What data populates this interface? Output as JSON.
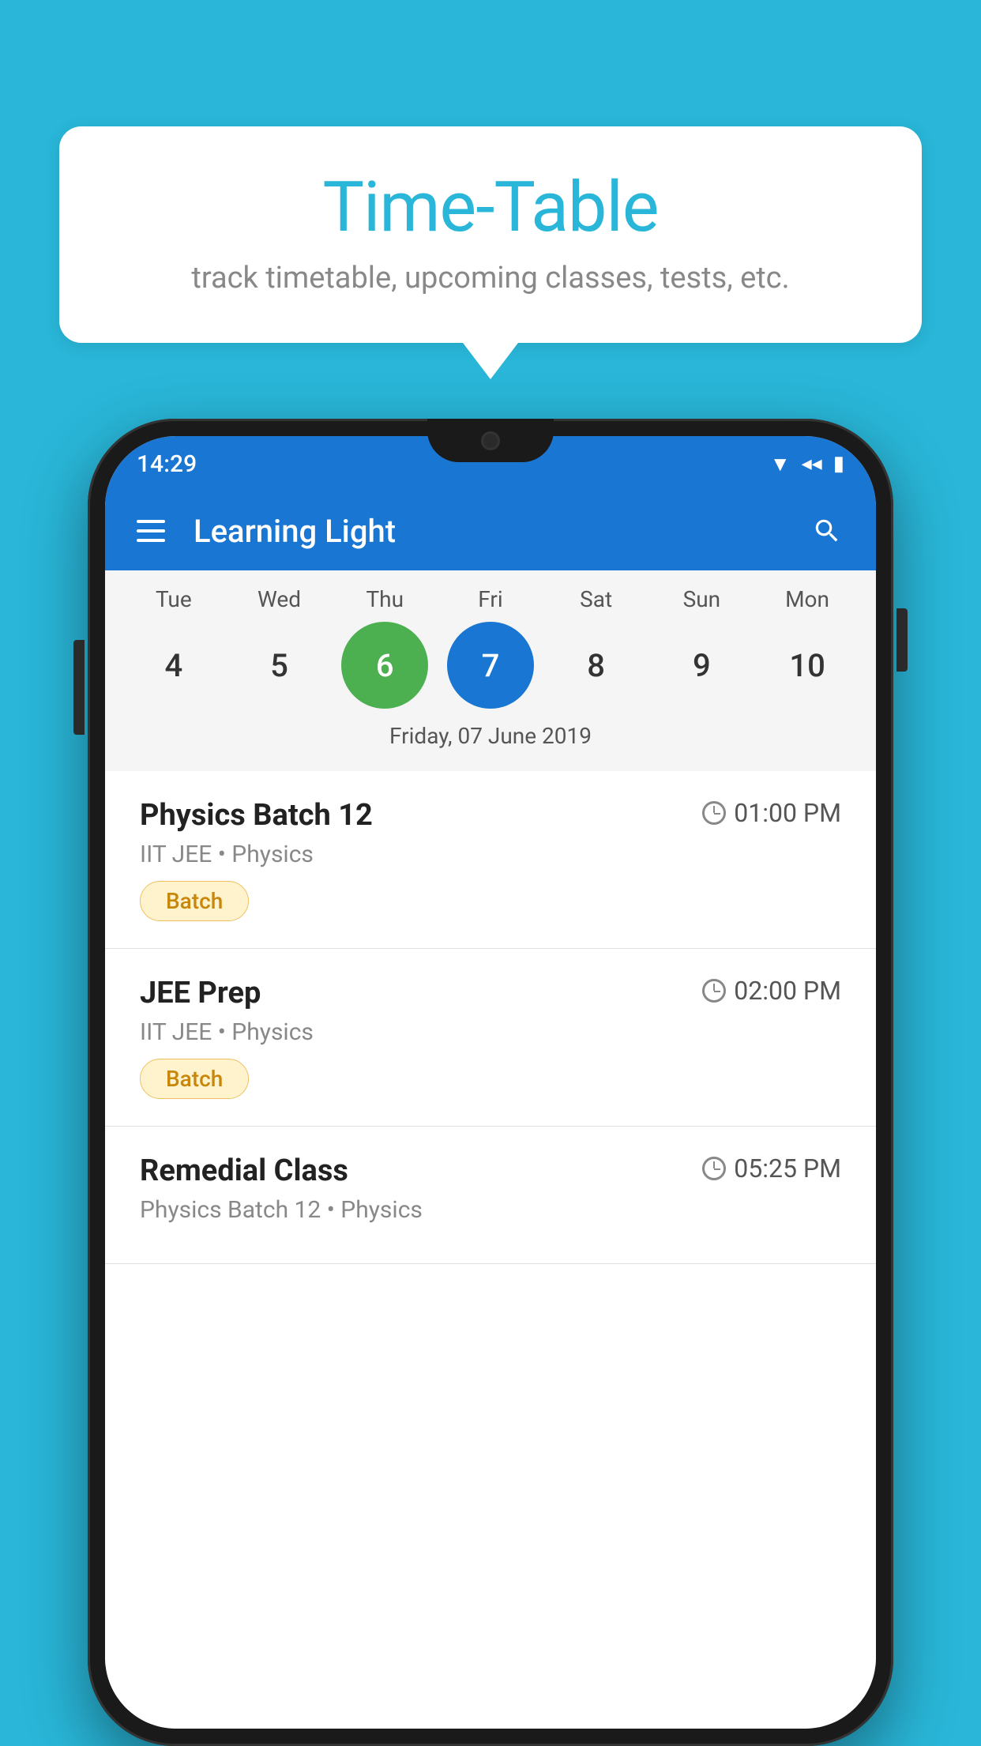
{
  "background_color": "#29b6d8",
  "speech_bubble": {
    "title": "Time-Table",
    "subtitle": "track timetable, upcoming classes, tests, etc."
  },
  "phone": {
    "status_bar": {
      "time": "14:29"
    },
    "app_bar": {
      "title": "Learning Light"
    },
    "calendar": {
      "days": [
        {
          "name": "Tue",
          "num": "4",
          "state": "normal"
        },
        {
          "name": "Wed",
          "num": "5",
          "state": "normal"
        },
        {
          "name": "Thu",
          "num": "6",
          "state": "today"
        },
        {
          "name": "Fri",
          "num": "7",
          "state": "selected"
        },
        {
          "name": "Sat",
          "num": "8",
          "state": "normal"
        },
        {
          "name": "Sun",
          "num": "9",
          "state": "normal"
        },
        {
          "name": "Mon",
          "num": "10",
          "state": "normal"
        }
      ],
      "selected_date_label": "Friday, 07 June 2019"
    },
    "schedule": [
      {
        "name": "Physics Batch 12",
        "time": "01:00 PM",
        "meta": "IIT JEE • Physics",
        "tag": "Batch"
      },
      {
        "name": "JEE Prep",
        "time": "02:00 PM",
        "meta": "IIT JEE • Physics",
        "tag": "Batch"
      },
      {
        "name": "Remedial Class",
        "time": "05:25 PM",
        "meta": "Physics Batch 12 • Physics",
        "tag": ""
      }
    ]
  }
}
